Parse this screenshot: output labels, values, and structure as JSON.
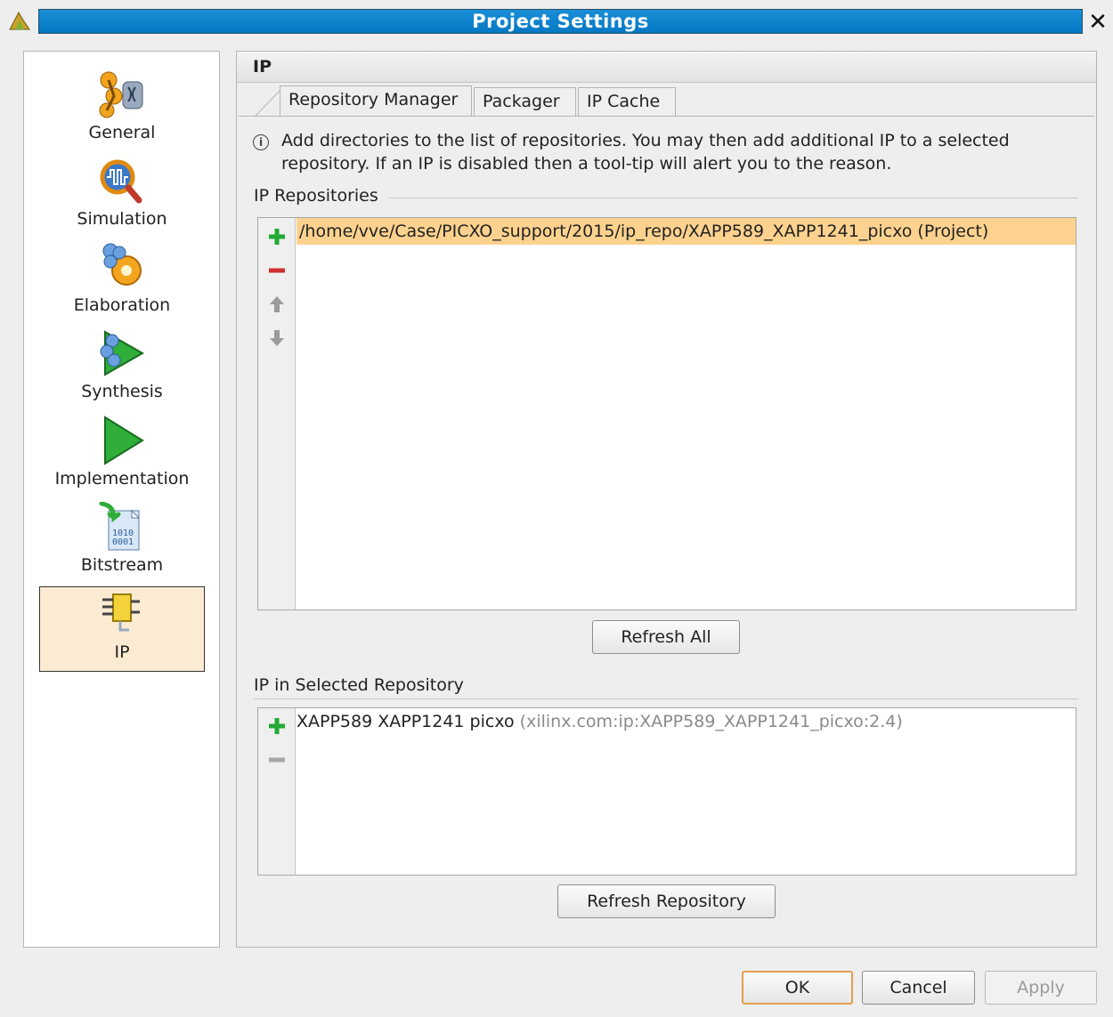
{
  "window": {
    "title": "Project Settings",
    "close_label": "✕"
  },
  "nav": {
    "items": [
      {
        "label": "General",
        "icon": "general-icon"
      },
      {
        "label": "Simulation",
        "icon": "simulation-icon"
      },
      {
        "label": "Elaboration",
        "icon": "elaboration-icon"
      },
      {
        "label": "Synthesis",
        "icon": "synthesis-icon"
      },
      {
        "label": "Implementation",
        "icon": "implementation-icon"
      },
      {
        "label": "Bitstream",
        "icon": "bitstream-icon"
      },
      {
        "label": "IP",
        "icon": "ip-icon"
      }
    ],
    "selected": "IP"
  },
  "panel": {
    "title": "IP",
    "tabs": [
      {
        "label": "Repository Manager",
        "active": true
      },
      {
        "label": "Packager",
        "active": false
      },
      {
        "label": "IP Cache",
        "active": false
      }
    ],
    "info_text": "Add directories to the list of repositories. You may then add additional IP to a selected repository. If an IP is disabled then a tool-tip will alert you to the reason.",
    "repositories": {
      "label": "IP Repositories",
      "items": [
        {
          "path": "/home/vve/Case/PICXO_support/2015/ip_repo/XAPP589_XAPP1241_picxo (Project)",
          "selected": true
        }
      ],
      "refresh_label": "Refresh All"
    },
    "selected_repo": {
      "label": "IP in Selected Repository",
      "items": [
        {
          "name": "XAPP589 XAPP1241 picxo",
          "vlnv": "(xilinx.com:ip:XAPP589_XAPP1241_picxo:2.4)"
        }
      ],
      "refresh_label": "Refresh Repository"
    }
  },
  "footer": {
    "ok_label": "OK",
    "cancel_label": "Cancel",
    "apply_label": "Apply"
  },
  "colors": {
    "title_bar": "#0a7fcc",
    "selected_nav": "#fcebd3",
    "selected_row": "#fdd28e",
    "add_green": "#22aa33",
    "remove_red": "#d03030",
    "default_button_border": "#e0a050"
  }
}
